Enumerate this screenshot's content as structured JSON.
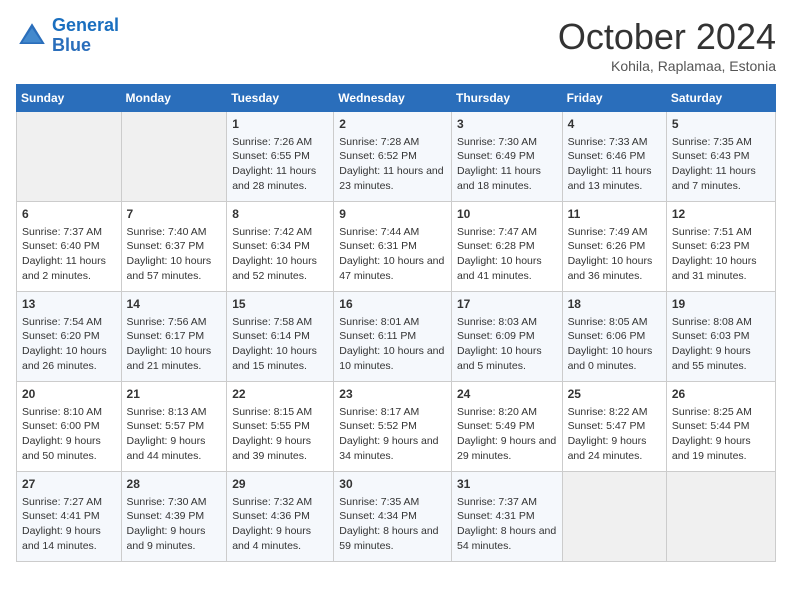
{
  "header": {
    "logo_line1": "General",
    "logo_line2": "Blue",
    "month": "October 2024",
    "location": "Kohila, Raplamaa, Estonia"
  },
  "days_of_week": [
    "Sunday",
    "Monday",
    "Tuesday",
    "Wednesday",
    "Thursday",
    "Friday",
    "Saturday"
  ],
  "weeks": [
    [
      {
        "day": "",
        "info": ""
      },
      {
        "day": "",
        "info": ""
      },
      {
        "day": "1",
        "info": "Sunrise: 7:26 AM\nSunset: 6:55 PM\nDaylight: 11 hours and 28 minutes."
      },
      {
        "day": "2",
        "info": "Sunrise: 7:28 AM\nSunset: 6:52 PM\nDaylight: 11 hours and 23 minutes."
      },
      {
        "day": "3",
        "info": "Sunrise: 7:30 AM\nSunset: 6:49 PM\nDaylight: 11 hours and 18 minutes."
      },
      {
        "day": "4",
        "info": "Sunrise: 7:33 AM\nSunset: 6:46 PM\nDaylight: 11 hours and 13 minutes."
      },
      {
        "day": "5",
        "info": "Sunrise: 7:35 AM\nSunset: 6:43 PM\nDaylight: 11 hours and 7 minutes."
      }
    ],
    [
      {
        "day": "6",
        "info": "Sunrise: 7:37 AM\nSunset: 6:40 PM\nDaylight: 11 hours and 2 minutes."
      },
      {
        "day": "7",
        "info": "Sunrise: 7:40 AM\nSunset: 6:37 PM\nDaylight: 10 hours and 57 minutes."
      },
      {
        "day": "8",
        "info": "Sunrise: 7:42 AM\nSunset: 6:34 PM\nDaylight: 10 hours and 52 minutes."
      },
      {
        "day": "9",
        "info": "Sunrise: 7:44 AM\nSunset: 6:31 PM\nDaylight: 10 hours and 47 minutes."
      },
      {
        "day": "10",
        "info": "Sunrise: 7:47 AM\nSunset: 6:28 PM\nDaylight: 10 hours and 41 minutes."
      },
      {
        "day": "11",
        "info": "Sunrise: 7:49 AM\nSunset: 6:26 PM\nDaylight: 10 hours and 36 minutes."
      },
      {
        "day": "12",
        "info": "Sunrise: 7:51 AM\nSunset: 6:23 PM\nDaylight: 10 hours and 31 minutes."
      }
    ],
    [
      {
        "day": "13",
        "info": "Sunrise: 7:54 AM\nSunset: 6:20 PM\nDaylight: 10 hours and 26 minutes."
      },
      {
        "day": "14",
        "info": "Sunrise: 7:56 AM\nSunset: 6:17 PM\nDaylight: 10 hours and 21 minutes."
      },
      {
        "day": "15",
        "info": "Sunrise: 7:58 AM\nSunset: 6:14 PM\nDaylight: 10 hours and 15 minutes."
      },
      {
        "day": "16",
        "info": "Sunrise: 8:01 AM\nSunset: 6:11 PM\nDaylight: 10 hours and 10 minutes."
      },
      {
        "day": "17",
        "info": "Sunrise: 8:03 AM\nSunset: 6:09 PM\nDaylight: 10 hours and 5 minutes."
      },
      {
        "day": "18",
        "info": "Sunrise: 8:05 AM\nSunset: 6:06 PM\nDaylight: 10 hours and 0 minutes."
      },
      {
        "day": "19",
        "info": "Sunrise: 8:08 AM\nSunset: 6:03 PM\nDaylight: 9 hours and 55 minutes."
      }
    ],
    [
      {
        "day": "20",
        "info": "Sunrise: 8:10 AM\nSunset: 6:00 PM\nDaylight: 9 hours and 50 minutes."
      },
      {
        "day": "21",
        "info": "Sunrise: 8:13 AM\nSunset: 5:57 PM\nDaylight: 9 hours and 44 minutes."
      },
      {
        "day": "22",
        "info": "Sunrise: 8:15 AM\nSunset: 5:55 PM\nDaylight: 9 hours and 39 minutes."
      },
      {
        "day": "23",
        "info": "Sunrise: 8:17 AM\nSunset: 5:52 PM\nDaylight: 9 hours and 34 minutes."
      },
      {
        "day": "24",
        "info": "Sunrise: 8:20 AM\nSunset: 5:49 PM\nDaylight: 9 hours and 29 minutes."
      },
      {
        "day": "25",
        "info": "Sunrise: 8:22 AM\nSunset: 5:47 PM\nDaylight: 9 hours and 24 minutes."
      },
      {
        "day": "26",
        "info": "Sunrise: 8:25 AM\nSunset: 5:44 PM\nDaylight: 9 hours and 19 minutes."
      }
    ],
    [
      {
        "day": "27",
        "info": "Sunrise: 7:27 AM\nSunset: 4:41 PM\nDaylight: 9 hours and 14 minutes."
      },
      {
        "day": "28",
        "info": "Sunrise: 7:30 AM\nSunset: 4:39 PM\nDaylight: 9 hours and 9 minutes."
      },
      {
        "day": "29",
        "info": "Sunrise: 7:32 AM\nSunset: 4:36 PM\nDaylight: 9 hours and 4 minutes."
      },
      {
        "day": "30",
        "info": "Sunrise: 7:35 AM\nSunset: 4:34 PM\nDaylight: 8 hours and 59 minutes."
      },
      {
        "day": "31",
        "info": "Sunrise: 7:37 AM\nSunset: 4:31 PM\nDaylight: 8 hours and 54 minutes."
      },
      {
        "day": "",
        "info": ""
      },
      {
        "day": "",
        "info": ""
      }
    ]
  ]
}
